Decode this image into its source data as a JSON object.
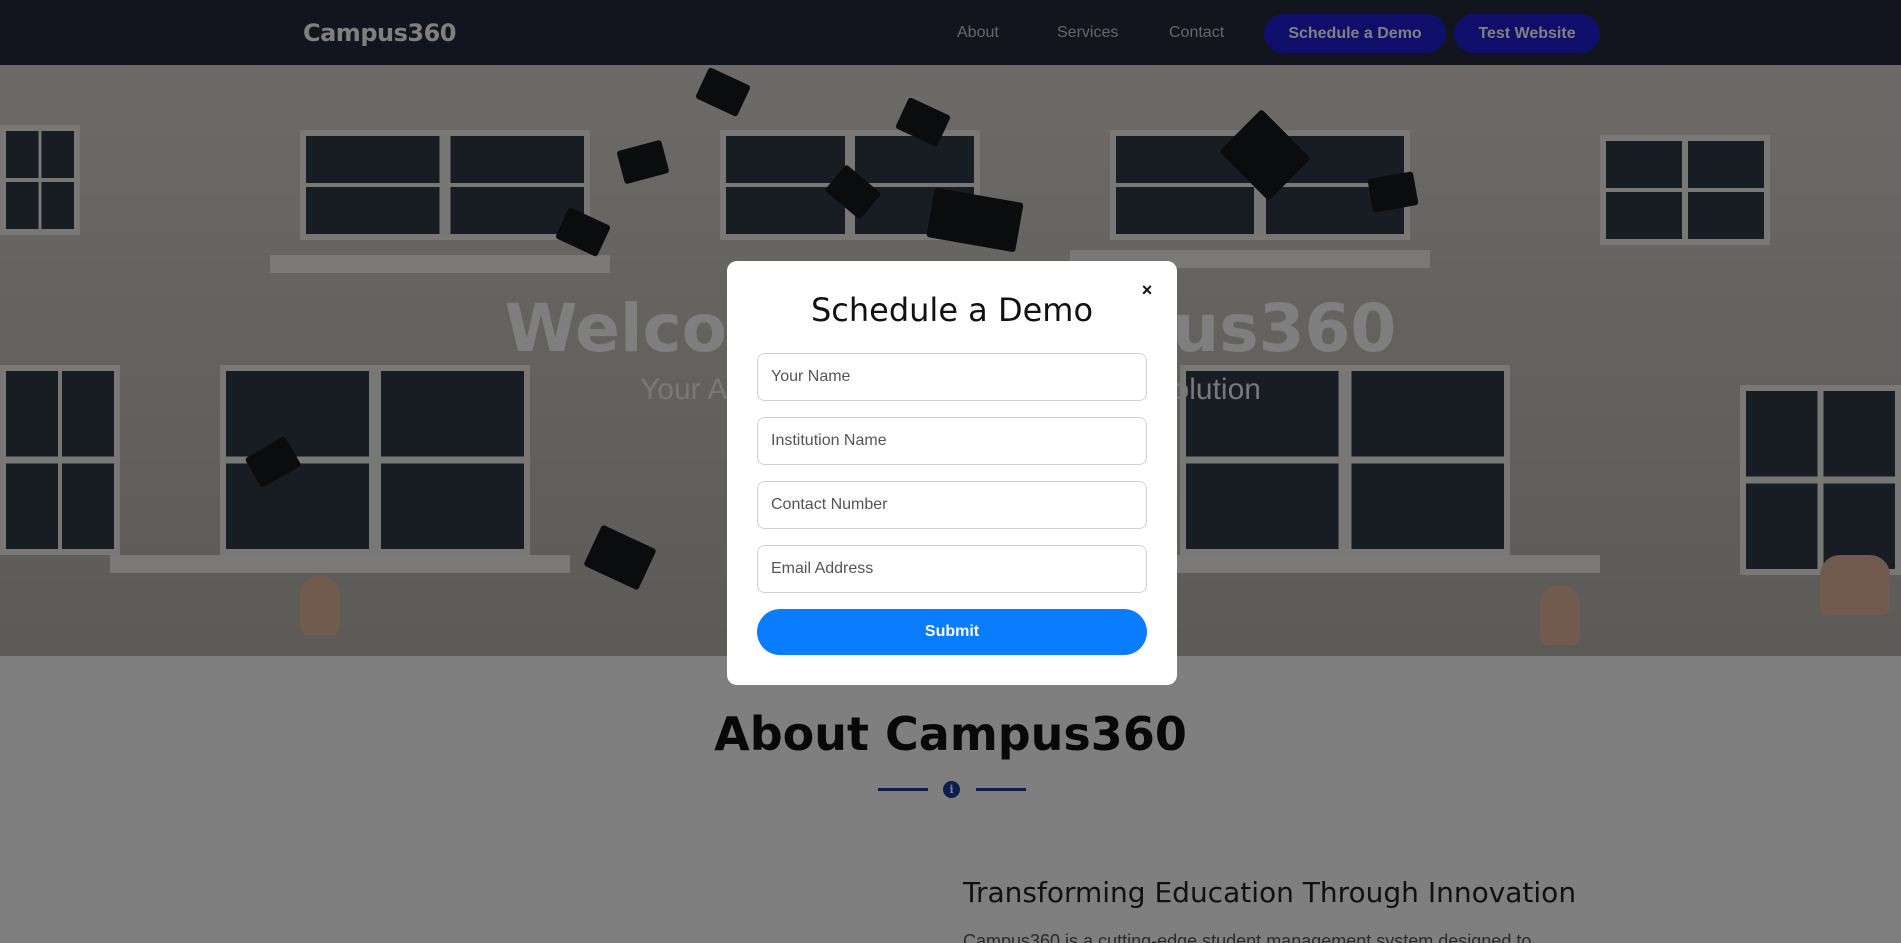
{
  "navbar": {
    "brand": "Campus360",
    "links": [
      "About",
      "Services",
      "Contact"
    ],
    "demo_button": "Schedule a Demo",
    "test_button": "Test Website"
  },
  "hero": {
    "title": "Welcome to Campus360",
    "subtitle": "Your All-in-One Campus Management Solution"
  },
  "about": {
    "title": "About Campus360",
    "divider_icon": "i",
    "subtitle": "Transforming Education Through Innovation",
    "text": "Campus360 is a cutting-edge student management system designed to"
  },
  "modal": {
    "title": "Schedule a Demo",
    "close": "×",
    "fields": [
      {
        "placeholder": "Your Name"
      },
      {
        "placeholder": "Institution Name"
      },
      {
        "placeholder": "Contact Number"
      },
      {
        "placeholder": "Email Address"
      }
    ],
    "submit": "Submit"
  },
  "colors": {
    "navbar_bg": "#262b3d",
    "nav_button": "#1f1fd6",
    "submit_button": "#0a7cff",
    "divider": "#1a3a9c"
  },
  "icons": [
    "close-icon",
    "info-icon"
  ]
}
